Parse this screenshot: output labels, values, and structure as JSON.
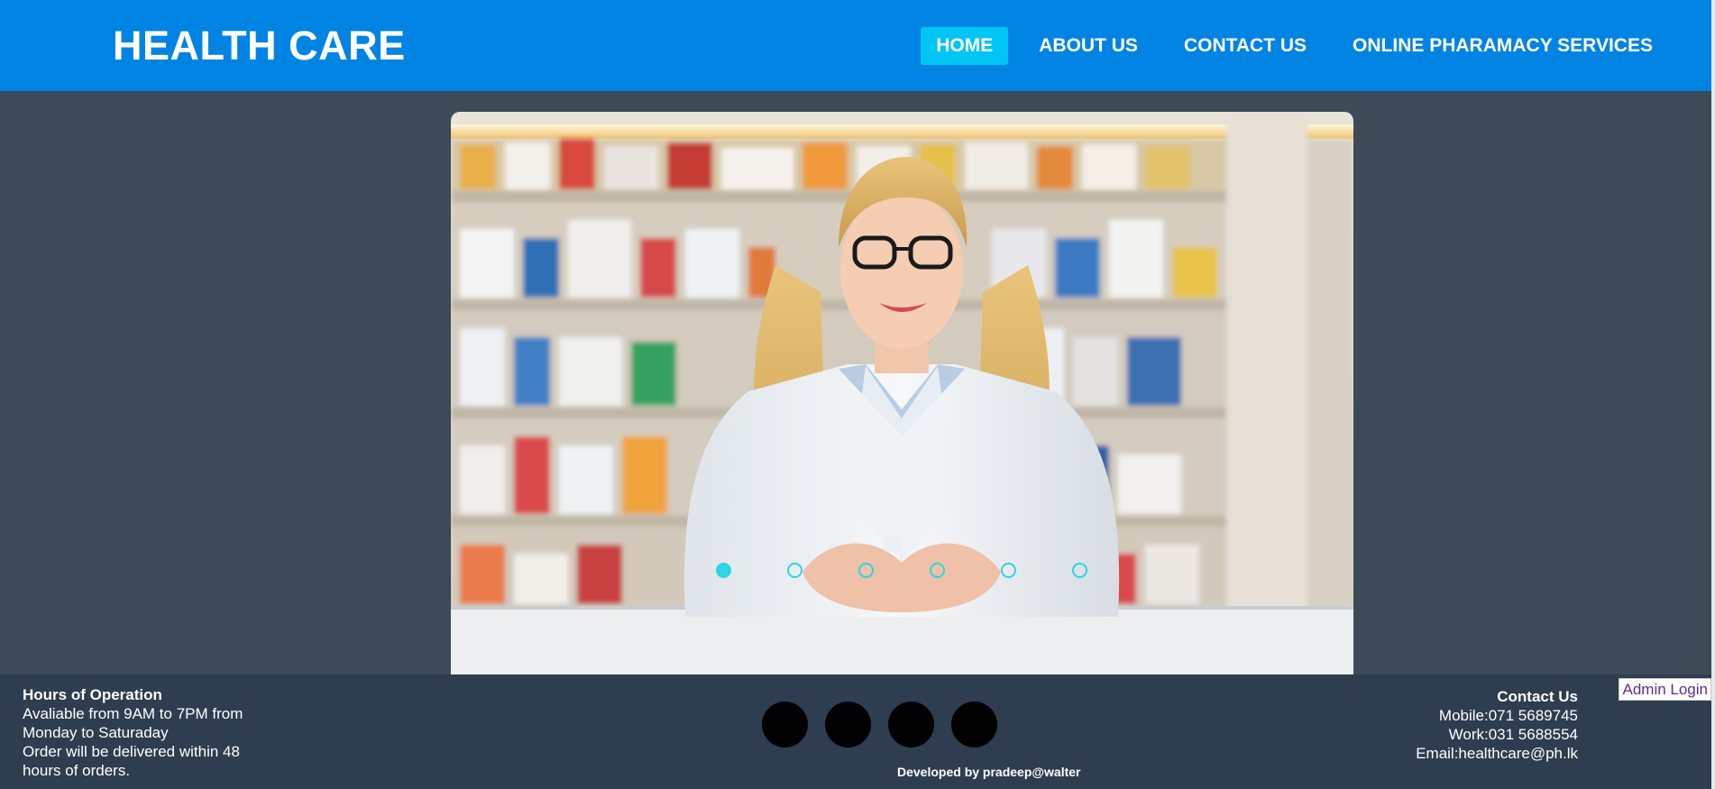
{
  "header": {
    "brand": "HEALTH CARE",
    "nav": [
      {
        "label": "HOME",
        "active": true
      },
      {
        "label": "ABOUT US",
        "active": false
      },
      {
        "label": "CONTACT US",
        "active": false
      },
      {
        "label": "ONLINE PHARAMACY SERVICES",
        "active": false
      }
    ],
    "bg_color": "#0084e4",
    "active_color": "#00c5f5"
  },
  "slider": {
    "image": "pharmacist smiling at counter in front of pharmacy shelves",
    "dot_count": 6,
    "active_dot": 0,
    "dot_color": "#2fd4e6"
  },
  "footer": {
    "hours": {
      "title": "Hours of Operation",
      "line1": "Avaliable from 9AM to 7PM from Monday to Saturaday",
      "line2": "Order will be delivered within 48 hours of orders."
    },
    "social_count": 4,
    "credit": "Developed by pradeep@walter",
    "contact": {
      "title": "Contact Us",
      "mobile": "Mobile:071 5689745",
      "work": "Work:031 5688554",
      "email": "Email:healthcare@ph.lk"
    }
  },
  "admin_login": "Admin Login"
}
